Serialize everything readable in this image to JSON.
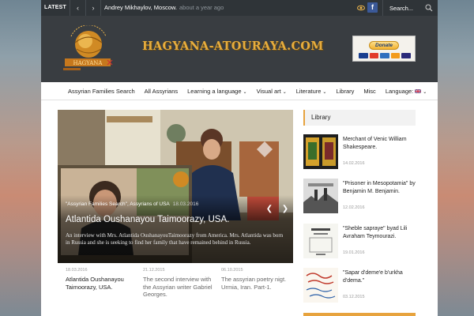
{
  "topbar": {
    "latest_label": "LATEST",
    "prev_arrow": "‹",
    "next_arrow": "›",
    "ticker_text": "Andrey Mikhaylov, Moscow.",
    "ticker_time": "about a year ago",
    "fb_label": "f",
    "search_placeholder": "Search..."
  },
  "header": {
    "logo_text": "HAGYANA",
    "site_title": "HAGYANA-ATOURAYA.COM",
    "donate_label": "Donate",
    "colors": {
      "title": "#e7ad3e",
      "header_bg": "#393d41",
      "accent": "#e7a33e"
    }
  },
  "nav": {
    "items": [
      {
        "label": "Assyrian Families Search",
        "has_dropdown": false
      },
      {
        "label": "All Assyrians",
        "has_dropdown": false
      },
      {
        "label": "Learning a language",
        "has_dropdown": true
      },
      {
        "label": "Visual art",
        "has_dropdown": true
      },
      {
        "label": "Literature",
        "has_dropdown": true
      },
      {
        "label": "Library",
        "has_dropdown": false
      },
      {
        "label": "Misc",
        "has_dropdown": false
      },
      {
        "label": "Language:",
        "has_dropdown": true
      }
    ],
    "chevron": "⌄"
  },
  "slider": {
    "category": "\"Assyrian Families Search\", Assyrians of USA",
    "date": "18.03.2016",
    "title": "Atlantida Oushanayou Taimoorazy, USA.",
    "excerpt": "An interview with Mrs. Atlantida OushanayouTaimoorazy from America. Mrs. Atlantida was born in Russia and she is seeking to find her family that have remained behind in Russia.",
    "prev": "❮",
    "next": "❯"
  },
  "posts": [
    {
      "date": "18.03.2016",
      "title": "Atlantida Oushanayou Taimoorazy, USA."
    },
    {
      "date": "21.12.2015",
      "title": "The second interview with the Assyrian writer Gabriel Georges."
    },
    {
      "date": "06.10.2015",
      "title": "The assyrian poetry nigt. Urmia, Iran. Part-1."
    }
  ],
  "sidebar": {
    "title": "Library",
    "items": [
      {
        "title": "Merchant of Venic William Shakespeare.",
        "date": "14.02.2016"
      },
      {
        "title": "\"Prisoner in Mesopotamia\" by Benjamin M. Benjamin.",
        "date": "12.02.2016"
      },
      {
        "title": "\"Sheble sapraye\" byad Lili Avraham Teymourazi.",
        "date": "19.01.2016"
      },
      {
        "title": "\"Sapar d'deme'e b'urkha d'dema.\"",
        "date": "03.12.2015"
      }
    ]
  }
}
